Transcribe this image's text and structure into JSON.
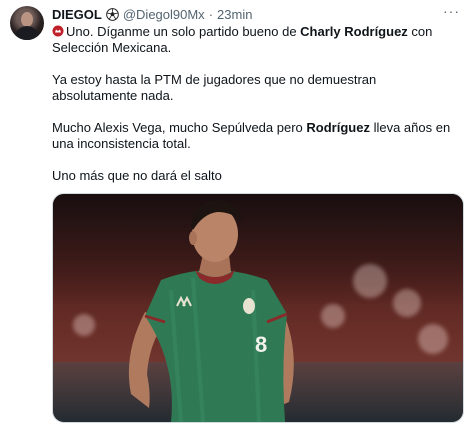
{
  "tweet": {
    "author_name": "DIEGOL",
    "handle": "@Diegol90Mx",
    "separator": "·",
    "time": "23min",
    "more_label": "···",
    "paragraphs": [
      {
        "parts": [
          {
            "text": "Uno. Díganme un solo partido bueno de ",
            "bold": false
          },
          {
            "text": "Charly Rodríguez",
            "bold": true
          },
          {
            "text": " con Selección Mexicana.",
            "bold": false
          }
        ]
      },
      {
        "parts": [
          {
            "text": "Ya estoy hasta la PTM  de jugadores que no demuestran absolutamente nada.",
            "bold": false
          }
        ]
      },
      {
        "parts": [
          {
            "text": "Mucho Alexis Vega, mucho Sepúlveda pero ",
            "bold": false
          },
          {
            "text": "Rodríguez",
            "bold": true
          },
          {
            "text": " lleva años en una inconsistencia total.",
            "bold": false
          }
        ]
      },
      {
        "parts": [
          {
            "text": "Uno más que no dará el salto",
            "bold": false
          }
        ]
      }
    ],
    "jersey_number": "8"
  },
  "icons": {
    "name_badge": "soccer-ball-icon",
    "text_prefix": "red-badge-icon",
    "more": "more-horizontal-icon"
  },
  "colors": {
    "text": "#0f1419",
    "secondary": "#536471",
    "jersey": "#2f7a55",
    "background": "#ffffff"
  }
}
